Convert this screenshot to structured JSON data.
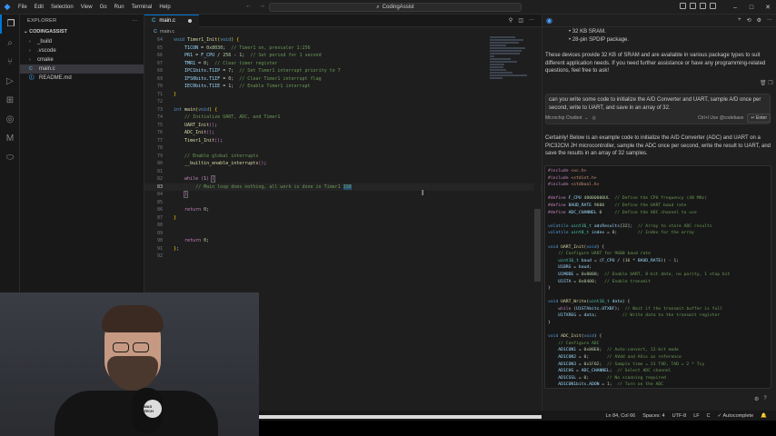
{
  "menu": [
    "File",
    "Edit",
    "Selection",
    "View",
    "Go",
    "Run",
    "Terminal",
    "Help"
  ],
  "command_center": "CodingAssist",
  "explorer": {
    "title": "EXPLORER",
    "root": "CODINGASSIST",
    "items": [
      {
        "label": "_build",
        "type": "folder"
      },
      {
        "label": ".vscode",
        "type": "folder"
      },
      {
        "label": "cmake",
        "type": "folder"
      },
      {
        "label": "main.c",
        "type": "c",
        "selected": true
      },
      {
        "label": "README.md",
        "type": "md"
      }
    ]
  },
  "editor": {
    "tab_label": "main.c",
    "breadcrumb": "main.c",
    "line_numbers": [
      "64",
      "65",
      "66",
      "67",
      "68",
      "69",
      "70",
      "71",
      "72",
      "73",
      "74",
      "75",
      "76",
      "77",
      "78",
      "79",
      "80",
      "81",
      "82",
      "83",
      "84",
      "85",
      "86",
      "87",
      "88",
      "89",
      "90",
      "91",
      "92"
    ],
    "active_line": "84"
  },
  "chat": {
    "items_top": [
      "32 KB SRAM.",
      "28-pin SPDIP package."
    ],
    "para1": "These devices provide 32 KB of SRAM and are available in various package types to suit different application needs. If you need further assistance or have any programming-related questions, feel free to ask!",
    "user_msg": "can you write some code to initialize the A/D Converter and UART, sample A/D once per second, write to UART, and save in an array of 32.",
    "input_model": "Microchip Chatbot",
    "input_hint": "Ctrl+I Use @codebase",
    "enter_label": "Enter",
    "para2": "Certainly! Below is an example code to initialize the A/D Converter (ADC) and UART on a PIC32CM JH microcontroller, sample the ADC once per second, write the result to UART, and save the results in an array of 32 samples."
  },
  "status": {
    "position": "Ln 84, Col 66",
    "spaces": "Spaces: 4",
    "encoding": "UTF-8",
    "eol": "LF",
    "lang": "C",
    "autocomplete": "Autocomplete"
  },
  "webcam": {
    "badge": "WAS TECH"
  }
}
